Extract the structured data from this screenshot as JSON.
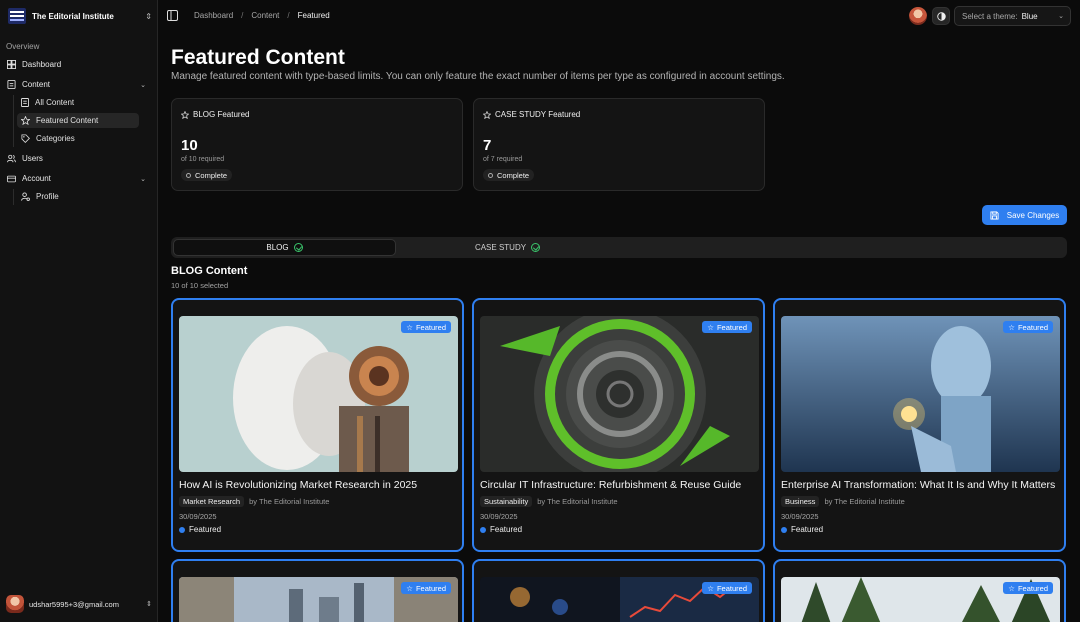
{
  "sidebar": {
    "org_name": "The Editorial Institute",
    "section_label": "Overview",
    "items": [
      {
        "label": "Dashboard"
      },
      {
        "label": "Content"
      },
      {
        "label": "Users"
      },
      {
        "label": "Account"
      }
    ],
    "content_sub": [
      {
        "label": "All Content"
      },
      {
        "label": "Featured Content"
      },
      {
        "label": "Categories"
      }
    ],
    "account_sub": [
      {
        "label": "Profile"
      }
    ],
    "user_email": "udshar5995+3@gmail.com"
  },
  "topbar": {
    "breadcrumbs": [
      "Dashboard",
      "Content",
      "Featured"
    ],
    "theme_label": "Select a theme:",
    "theme_value": "Blue"
  },
  "page": {
    "title": "Featured Content",
    "description": "Manage featured content with type-based limits. You can only feature the exact number of items per type as configured in account settings."
  },
  "stats": [
    {
      "title": "BLOG Featured",
      "count": "10",
      "required": "of 10 required",
      "status": "Complete"
    },
    {
      "title": "CASE STUDY Featured",
      "count": "7",
      "required": "of 7 required",
      "status": "Complete"
    }
  ],
  "save_label": "Save Changes",
  "tabs": [
    {
      "label": "BLOG",
      "active": true
    },
    {
      "label": "CASE STUDY",
      "active": false
    }
  ],
  "section": {
    "title": "BLOG Content",
    "subtitle": "10 of 10 selected"
  },
  "cards": [
    {
      "badge": "Featured",
      "title": "How AI is Revolutionizing Market Research in 2025",
      "category": "Market Research",
      "author": "by The Editorial Institute",
      "date": "30/09/2025",
      "status": "Featured"
    },
    {
      "badge": "Featured",
      "title": "Circular IT Infrastructure: Refurbishment & Reuse Guide",
      "category": "Sustainability",
      "author": "by The Editorial Institute",
      "date": "30/09/2025",
      "status": "Featured"
    },
    {
      "badge": "Featured",
      "title": "Enterprise AI Transformation: What It Is and Why It Matters",
      "category": "Business",
      "author": "by The Editorial Institute",
      "date": "30/09/2025",
      "status": "Featured"
    },
    {
      "badge": "Featured"
    },
    {
      "badge": "Featured"
    },
    {
      "badge": "Featured"
    }
  ],
  "colors": {
    "accent": "#2f7ff0",
    "success": "#3ac46b",
    "background": "#0b0b0b"
  }
}
